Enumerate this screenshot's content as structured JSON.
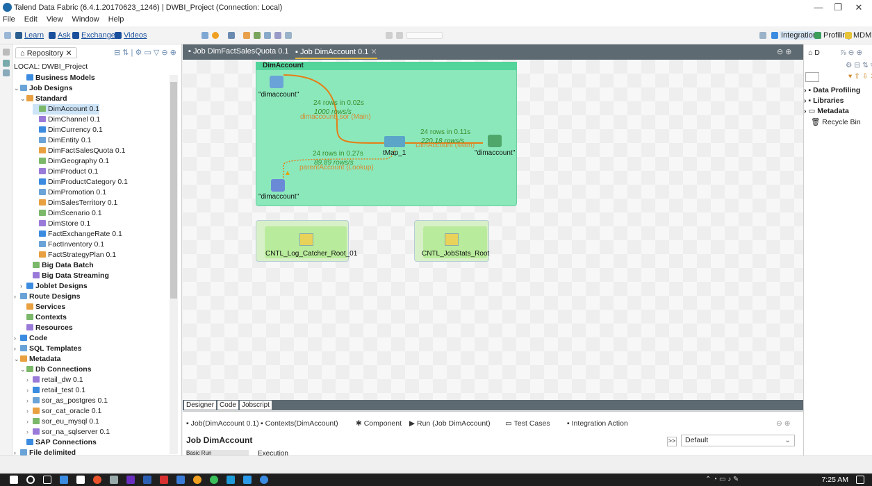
{
  "window": {
    "title": "Talend Data Fabric (6.4.1.20170623_1246) | DWBI_Project (Connection: Local)"
  },
  "menu": [
    "File",
    "Edit",
    "View",
    "Window",
    "Help"
  ],
  "toolbar": {
    "links": [
      "Learn",
      "Ask",
      "Exchange",
      "Videos"
    ],
    "perspectives": [
      "Integration",
      "Profiling",
      "MDM"
    ]
  },
  "repository": {
    "tab": "Repository",
    "root": "LOCAL: DWBI_Project",
    "items": [
      {
        "label": "Business Models",
        "bold": true,
        "indent": 1
      },
      {
        "label": "Job Designs",
        "bold": true,
        "indent": 0,
        "expander": "v"
      },
      {
        "label": "Standard",
        "bold": true,
        "indent": 1,
        "expander": "v"
      },
      {
        "label": "DimAccount 0.1",
        "indent": 3,
        "selected": true
      },
      {
        "label": "DimChannel 0.1",
        "indent": 3
      },
      {
        "label": "DimCurrency 0.1",
        "indent": 3
      },
      {
        "label": "DimEntity 0.1",
        "indent": 3
      },
      {
        "label": "DimFactSalesQuota 0.1",
        "indent": 3
      },
      {
        "label": "DimGeography 0.1",
        "indent": 3
      },
      {
        "label": "DimProduct 0.1",
        "indent": 3
      },
      {
        "label": "DimProductCategory 0.1",
        "indent": 3
      },
      {
        "label": "DimPromotion 0.1",
        "indent": 3
      },
      {
        "label": "DimSalesTerritory 0.1",
        "indent": 3
      },
      {
        "label": "DimScenario 0.1",
        "indent": 3
      },
      {
        "label": "DimStore 0.1",
        "indent": 3
      },
      {
        "label": "FactExchangeRate 0.1",
        "indent": 3
      },
      {
        "label": "FactInventory 0.1",
        "indent": 3
      },
      {
        "label": "FactStrategyPlan 0.1",
        "indent": 3
      },
      {
        "label": "Big Data Batch",
        "bold": true,
        "indent": 2
      },
      {
        "label": "Big Data Streaming",
        "bold": true,
        "indent": 2
      },
      {
        "label": "Joblet Designs",
        "bold": true,
        "indent": 1,
        "expander": ">"
      },
      {
        "label": "Route Designs",
        "bold": true,
        "indent": 0,
        "expander": ">"
      },
      {
        "label": "Services",
        "bold": true,
        "indent": 1
      },
      {
        "label": "Contexts",
        "bold": true,
        "indent": 1
      },
      {
        "label": "Resources",
        "bold": true,
        "indent": 1
      },
      {
        "label": "Code",
        "bold": true,
        "indent": 0,
        "expander": ">"
      },
      {
        "label": "SQL Templates",
        "bold": true,
        "indent": 0,
        "expander": ">"
      },
      {
        "label": "Metadata",
        "bold": true,
        "indent": 0,
        "expander": "v"
      },
      {
        "label": "Db Connections",
        "bold": true,
        "indent": 1,
        "expander": "v"
      },
      {
        "label": "retail_dw 0.1",
        "indent": 2,
        "expander": ">"
      },
      {
        "label": "retail_test 0.1",
        "indent": 2,
        "expander": ">"
      },
      {
        "label": "sor_as_postgres 0.1",
        "indent": 2,
        "expander": ">"
      },
      {
        "label": "sor_cat_oracle 0.1",
        "indent": 2,
        "expander": ">"
      },
      {
        "label": "sor_eu_mysql 0.1",
        "indent": 2,
        "expander": ">"
      },
      {
        "label": "sor_na_sqlserver 0.1",
        "indent": 2,
        "expander": ">"
      },
      {
        "label": "SAP Connections",
        "bold": true,
        "indent": 1
      },
      {
        "label": "File delimited",
        "bold": true,
        "indent": 0,
        "expander": ">"
      }
    ]
  },
  "editor_tabs": [
    "Job DimFactSalesQuota 0.1",
    "Job DimAccount 0.1"
  ],
  "canvas": {
    "subjob_title": "DimAccount",
    "input_main_label": "\"dimaccount\"",
    "input_lookup_label": "\"dimaccount\"",
    "output_label": "\"dimaccount\"",
    "tmap_label": "tMap_1",
    "flow_main_rows": "24 rows in 0.02s",
    "flow_main_rate": "1000 rows/s",
    "flow_main_name": "dimaccount_sor (Main)",
    "flow_out_rows": "24 rows in 0.11s",
    "flow_out_rate": "220.18 rows/s",
    "flow_out_name": "DimAccount (Main)",
    "flow_lookup_rows": "24 rows in 0.27s",
    "flow_lookup_rate": "89.89 rows/s",
    "flow_lookup_name": "parentAccount (Lookup)",
    "log_catcher": "CNTL_Log_Catcher_Root_01",
    "jobstats": "CNTL_JobStats_Root"
  },
  "designer_tabs": [
    "Designer",
    "Code",
    "Jobscript"
  ],
  "bottom": {
    "tabs": [
      "Job(DimAccount 0.1)",
      "Contexts(DimAccount)",
      "Component",
      "Run (Job DimAccount)",
      "Test Cases",
      "Integration Action"
    ],
    "title": "Job DimAccount",
    "basic_run": "Basic Run",
    "execution": "Execution",
    "context": "Default"
  },
  "right_panel": {
    "tab": "D",
    "items": [
      "Data Profiling",
      "Libraries",
      "Metadata",
      "Recycle Bin"
    ]
  },
  "taskbar": {
    "time": "7:25 AM"
  }
}
